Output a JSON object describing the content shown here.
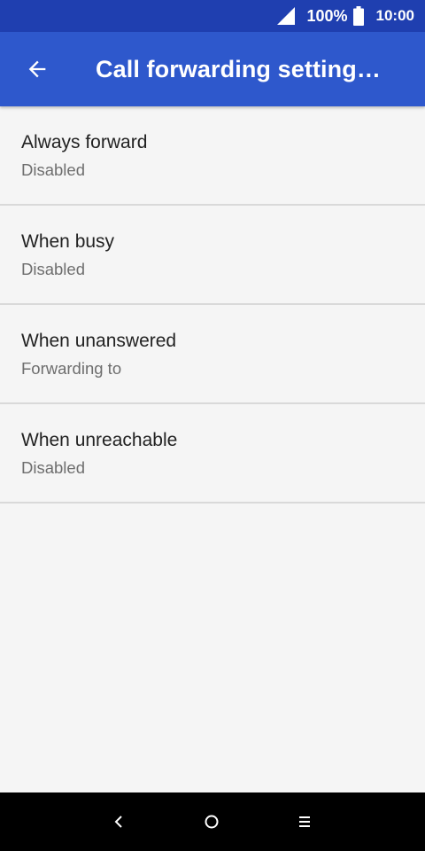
{
  "status_bar": {
    "battery_percent": "100%",
    "time": "10:00"
  },
  "app_bar": {
    "title": "Call forwarding setting…"
  },
  "items": [
    {
      "title": "Always forward",
      "subtitle": "Disabled"
    },
    {
      "title": "When busy",
      "subtitle": "Disabled"
    },
    {
      "title": "When unanswered",
      "subtitle": "Forwarding to"
    },
    {
      "title": "When unreachable",
      "subtitle": "Disabled"
    }
  ],
  "icons": {
    "status": [
      "signal-icon",
      "battery-icon"
    ],
    "app_bar": [
      "back-arrow-icon"
    ],
    "nav": [
      "nav-back-icon",
      "nav-home-icon",
      "nav-menu-icon"
    ]
  },
  "colors": {
    "status_bar": "#1f3fb0",
    "app_bar": "#2e58cc",
    "background": "#f5f5f5",
    "divider": "#d9d9d9"
  }
}
